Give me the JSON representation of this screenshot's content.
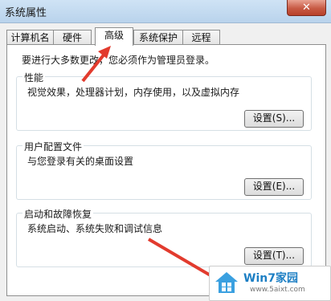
{
  "window": {
    "title": "系统属性",
    "close_label": "✕"
  },
  "tabs": [
    {
      "label": "计算机名",
      "active": false
    },
    {
      "label": "硬件",
      "active": false
    },
    {
      "label": "高级",
      "active": true
    },
    {
      "label": "系统保护",
      "active": false
    },
    {
      "label": "远程",
      "active": false
    }
  ],
  "note": "要进行大多数更改，您必须作为管理员登录。",
  "sections": [
    {
      "title": "性能",
      "description": "视觉效果，处理器计划，内存使用，以及虚拟内存",
      "button": "设置(S)..."
    },
    {
      "title": "用户配置文件",
      "description": "与您登录有关的桌面设置",
      "button": "设置(E)..."
    },
    {
      "title": "启动和故障恢复",
      "description": "系统启动、系统失败和调试信息",
      "button": "设置(T)..."
    }
  ],
  "watermark": {
    "main": "Win7家园",
    "sub": "www.5aixt.com"
  },
  "colors": {
    "arrow": "#e23b2e",
    "titlebar": "#c4dbf1",
    "close": "#c75a44"
  }
}
